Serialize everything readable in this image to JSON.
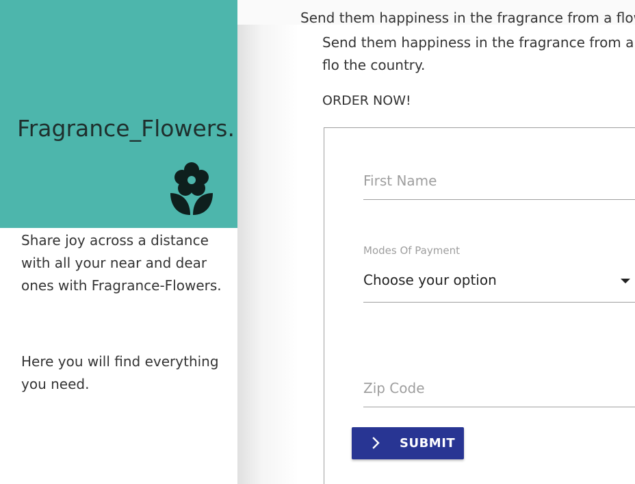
{
  "sidebar": {
    "brand_title": "Fragrance_Flowers.",
    "brand_icon": "flower-icon",
    "tagline": "Share joy across a distance with all your near and dear ones with Fragrance-Flowers.",
    "note": "Here you will find everything you need.",
    "panel_color": "#4db6ac"
  },
  "main": {
    "ghost_line": "Send them happiness in the fragrance from a flow",
    "intro": "Send them happiness in the fragrance from a flo the country.",
    "order_now": "ORDER NOW!"
  },
  "form": {
    "first_name_placeholder": "First Name",
    "payment_label": "Modes Of Payment",
    "payment_selected": "Choose your option",
    "zip_placeholder": "Zip Code",
    "submit_label": "SUBMIT",
    "submit_icon": "chevron-right-icon",
    "submit_color": "#283593"
  }
}
